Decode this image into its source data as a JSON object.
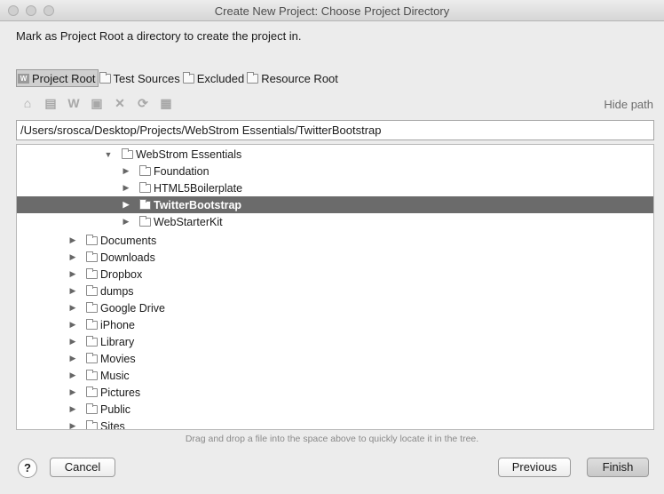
{
  "window": {
    "title": "Create New Project: Choose Project Directory"
  },
  "instruction": "Mark as Project Root a directory to create the project in.",
  "root_tabs": [
    {
      "label": "Project Root",
      "icon": "webstorm-icon",
      "selected": true
    },
    {
      "label": "Test Sources",
      "icon": "folder-icon",
      "selected": false
    },
    {
      "label": "Excluded",
      "icon": "folder-icon",
      "selected": false
    },
    {
      "label": "Resource Root",
      "icon": "folder-icon",
      "selected": false
    }
  ],
  "toolbar": {
    "icons": [
      "home-icon",
      "desktop-icon",
      "project-icon",
      "new-folder-icon",
      "delete-icon",
      "refresh-icon",
      "show-hidden-icon"
    ],
    "hide_path_label": "Hide path"
  },
  "path": {
    "value": "/Users/srosca/Desktop/Projects/WebStrom Essentials/TwitterBootstrap"
  },
  "tree": {
    "rows": [
      {
        "label": "WebStrom Essentials",
        "expanded": true,
        "level": 2
      },
      {
        "label": "Foundation",
        "expanded": false,
        "level": 3
      },
      {
        "label": "HTML5Boilerplate",
        "expanded": false,
        "level": 3
      },
      {
        "label": "TwitterBootstrap",
        "expanded": false,
        "level": 3,
        "selected": true
      },
      {
        "label": "WebStarterKit",
        "expanded": false,
        "level": 3
      },
      {
        "label": "",
        "expanded": false,
        "level": 0,
        "blank": true
      },
      {
        "label": "Documents",
        "expanded": false,
        "level": 1
      },
      {
        "label": "Downloads",
        "expanded": false,
        "level": 1
      },
      {
        "label": "Dropbox",
        "expanded": false,
        "level": 1
      },
      {
        "label": "dumps",
        "expanded": false,
        "level": 1
      },
      {
        "label": "Google Drive",
        "expanded": false,
        "level": 1
      },
      {
        "label": "iPhone",
        "expanded": false,
        "level": 1
      },
      {
        "label": "Library",
        "expanded": false,
        "level": 1
      },
      {
        "label": "Movies",
        "expanded": false,
        "level": 1
      },
      {
        "label": "Music",
        "expanded": false,
        "level": 1
      },
      {
        "label": "Pictures",
        "expanded": false,
        "level": 1
      },
      {
        "label": "Public",
        "expanded": false,
        "level": 1
      },
      {
        "label": "Sites",
        "expanded": false,
        "level": 1
      }
    ]
  },
  "hint": "Drag and drop a file into the space above to quickly locate it in the tree.",
  "buttons": {
    "help": "?",
    "cancel": "Cancel",
    "previous": "Previous",
    "finish": "Finish"
  },
  "colors": {
    "selection": "#6b6b6b",
    "background": "#ececec"
  }
}
